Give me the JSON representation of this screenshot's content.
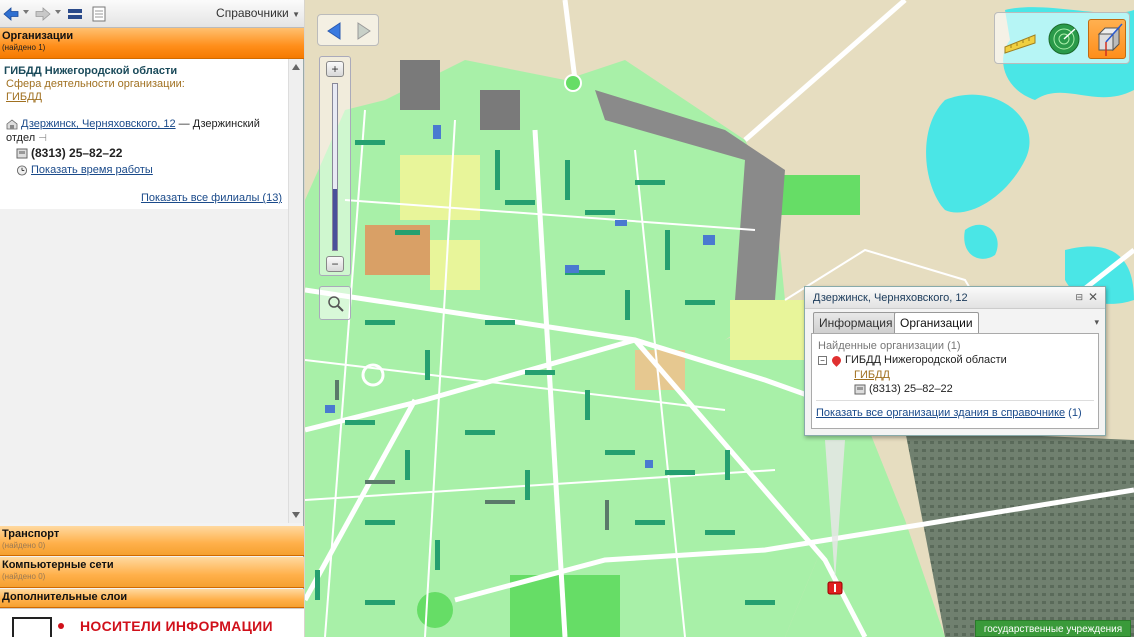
{
  "toolbar": {
    "directories_label": "Справочники"
  },
  "sections": {
    "organizations": {
      "title": "Организации",
      "subtitle": "(найдено 1)"
    },
    "transport": {
      "title": "Транспорт",
      "subtitle": "(найдено 0)"
    },
    "networks": {
      "title": "Компьютерные сети",
      "subtitle": "(найдено 0)"
    },
    "layers": {
      "title": "Дополнительные слои"
    }
  },
  "result": {
    "name": "ГИБДД Нижегородской области",
    "sphere_label": "Сфера деятельности организации:",
    "sphere_value": "ГИБДД",
    "address_link": "Дзержинск, Черняховского, 12",
    "address_rest": " — Дзержинский отдел",
    "phone": "(8313) 25–82–22",
    "hours_link": "Показать время работы",
    "branches_link": "Показать все филиалы (13)"
  },
  "ad": {
    "text": "НОСИТЕЛИ ИНФОРМАЦИИ"
  },
  "popup": {
    "title": "Дзержинск, Черняховского, 12",
    "tabs": [
      {
        "label": "Информация",
        "active": false
      },
      {
        "label": "Организации",
        "active": true
      }
    ],
    "found_label": "Найденные организации (1)",
    "org_name": "ГИБДД Нижегородской области",
    "org_category": "ГИБДД",
    "org_phone": "(8313) 25–82–22",
    "all_orgs_link": "Показать все организации здания в справочнике",
    "all_orgs_count": " (1)"
  },
  "map": {
    "legend_tag": "государственные учреждения",
    "colors": {
      "residential": "#a8f0a8",
      "building": "#25a070",
      "industrial": "#6a7a6a",
      "water": "#4ae6e6",
      "sand": "#e6ddc0",
      "road": "#ffffff",
      "accent": "#ff8e1a"
    }
  }
}
